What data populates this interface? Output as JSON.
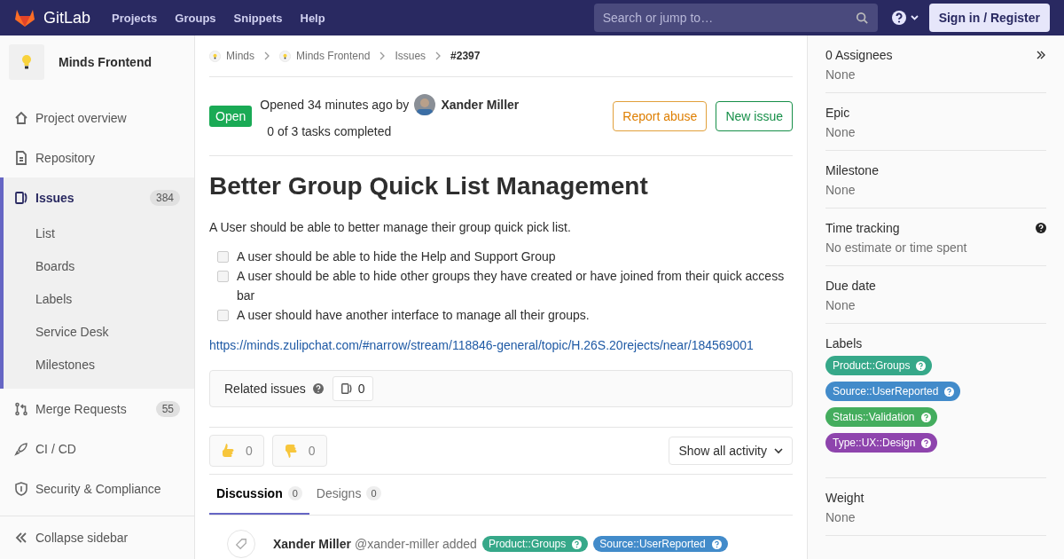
{
  "navbar": {
    "brand": "GitLab",
    "links": [
      "Projects",
      "Groups",
      "Snippets",
      "Help"
    ],
    "search": {
      "placeholder": "Search or jump to…"
    },
    "sign_in": "Sign in / Register"
  },
  "sidebar": {
    "project": "Minds Frontend",
    "items": [
      {
        "label": "Project overview",
        "kind": "home",
        "selected": false
      },
      {
        "label": "Repository",
        "kind": "doc",
        "selected": false
      },
      {
        "label": "Issues",
        "kind": "issues",
        "count": "384",
        "selected": true,
        "children": [
          {
            "label": "List"
          },
          {
            "label": "Boards"
          },
          {
            "label": "Labels"
          },
          {
            "label": "Service Desk"
          },
          {
            "label": "Milestones"
          }
        ]
      },
      {
        "label": "Merge Requests",
        "kind": "merge",
        "count": "55",
        "selected": false
      },
      {
        "label": "CI / CD",
        "kind": "rocket",
        "selected": false
      },
      {
        "label": "Security & Compliance",
        "kind": "shield",
        "selected": false
      }
    ],
    "collapse": "Collapse sidebar"
  },
  "breadcrumbs": [
    "Minds",
    "Minds Frontend",
    "Issues",
    "#2397"
  ],
  "issue": {
    "status": "Open",
    "opened": "Opened 34 minutes ago by",
    "author": "Xander Miller",
    "tasks_status": "0 of 3 tasks completed",
    "buttons": [
      "Report abuse",
      "New issue"
    ],
    "title": "Better Group Quick List Management",
    "description": "A User should be able to better manage their group quick pick list.",
    "tasks": [
      {
        "text": "A user should be able to hide the Help and Support Group",
        "checked": false
      },
      {
        "text": "A user should be able to hide other groups they have created or have joined from their quick access bar",
        "checked": false
      },
      {
        "text": "A user should have another interface to manage all their groups.",
        "checked": false
      }
    ],
    "link": "https://minds.zulipchat.com/#narrow/stream/118846-general/topic/H.26S.20rejects/near/184569001"
  },
  "related": {
    "label": "Related issues",
    "count": "0"
  },
  "reactions": [
    {
      "kind": "up",
      "count": "0"
    },
    {
      "kind": "down",
      "count": "0"
    }
  ],
  "activity_filter": "Show all activity",
  "tabs": [
    {
      "label": "Discussion",
      "count": "0",
      "selected": true
    },
    {
      "label": "Designs",
      "count": "0",
      "selected": false
    }
  ],
  "note": {
    "author": "Xander Miller",
    "handle": "@xander-miller added",
    "labels": [
      {
        "text": "Product::Groups",
        "color": "#36a889"
      },
      {
        "text": "Source::UserReported",
        "color": "#428bca"
      }
    ]
  },
  "right_sidebar": {
    "blocks": [
      {
        "kind": "text",
        "title": "0 Assignees",
        "value": "None"
      },
      {
        "kind": "text",
        "title": "Epic",
        "value": "None"
      },
      {
        "kind": "text",
        "title": "Milestone",
        "value": "None"
      },
      {
        "kind": "text",
        "title": "Time tracking",
        "value": "No estimate or time spent"
      },
      {
        "kind": "text",
        "title": "Due date",
        "value": "None"
      },
      {
        "kind": "labels",
        "title": "Labels",
        "labels": [
          {
            "text": "Product::Groups",
            "color": "#36a889"
          },
          {
            "text": "Source::UserReported",
            "color": "#428bca"
          },
          {
            "text": "Status::Validation",
            "color": "#44ad5e"
          },
          {
            "text": "Type::UX::Design",
            "color": "#8e44ad"
          }
        ]
      },
      {
        "kind": "text",
        "title": "Weight",
        "value": "None"
      }
    ]
  }
}
